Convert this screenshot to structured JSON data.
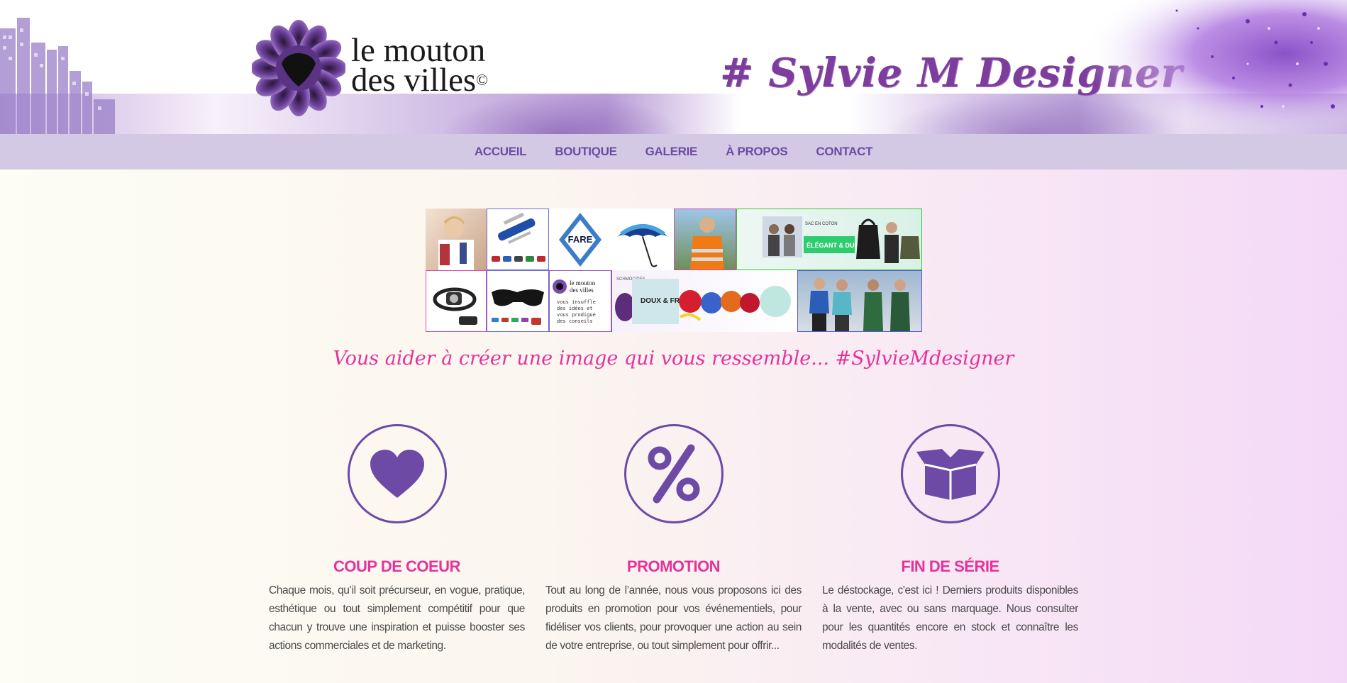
{
  "header": {
    "logo_line1": "le mouton",
    "logo_line2": "des villes",
    "logo_copyright": "©",
    "signature": "# Sylvie M Designer"
  },
  "nav": {
    "items": [
      "ACCUEIL",
      "BOUTIQUE",
      "GALERIE",
      "À PROPOS",
      "CONTACT"
    ]
  },
  "collage": {
    "fare_label": "FARE",
    "banner_text": "ÉLÉGANT & DURABLE",
    "banner_small": "SAC EN COTON",
    "mini_logo_line1": "le mouton",
    "mini_logo_line2": "des villes",
    "mini_logo_note": "vous insuffle des idées et vous prodigue des conseils",
    "candy_brand": "SCHMOOZIES",
    "candy_text": "DOUX & FRUITÉS"
  },
  "tagline": "Vous aider à créer une image qui vous ressemble... #SylvieMdesigner",
  "features": [
    {
      "icon": "heart-icon",
      "title": "COUP DE COEUR",
      "text": "Chaque mois, qu’il soit précurseur, en vogue, pratique, esthétique ou tout simplement compétitif pour que chacun y trouve une inspiration et puisse booster ses actions commerciales et de marketing."
    },
    {
      "icon": "percent-icon",
      "title": "PROMOTION",
      "text": "Tout au long de l’année, nous vous proposons ici des produits en promotion pour vos événementiels, pour fidéliser vos clients, pour provoquer une action au sein de votre entreprise, ou tout simplement pour offrir..."
    },
    {
      "icon": "open-box-icon",
      "title": "FIN DE SÉRIE",
      "text": "Le déstockage, c'est ici ! Derniers produits disponibles à la vente, avec ou sans marquage. Nous consulter pour les quantités encore en stock et connaître les modalités de ventes."
    }
  ],
  "colors": {
    "accent_purple": "#6c4aa5",
    "accent_pink": "#e6329a",
    "nav_bg": "#d3c9e4"
  }
}
